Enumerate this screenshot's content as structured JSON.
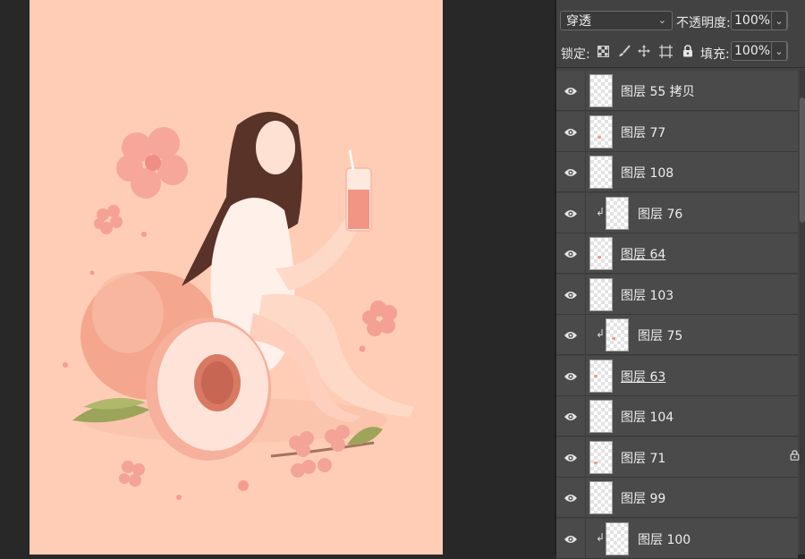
{
  "layers_panel": {
    "blend_mode": "穿透",
    "opacity_label": "不透明度:",
    "opacity_value": "100%",
    "lock_label": "锁定:",
    "fill_label": "填充:",
    "fill_value": "100%",
    "layers": [
      {
        "name": "图层 55 拷贝",
        "clipped": false,
        "underlined": false,
        "locked": false
      },
      {
        "name": "图层 77",
        "clipped": false,
        "underlined": false,
        "locked": false
      },
      {
        "name": "图层 108",
        "clipped": false,
        "underlined": false,
        "locked": false
      },
      {
        "name": "图层 76",
        "clipped": true,
        "underlined": false,
        "locked": false
      },
      {
        "name": "图层 64",
        "clipped": false,
        "underlined": true,
        "locked": false
      },
      {
        "name": "图层 103",
        "clipped": false,
        "underlined": false,
        "locked": false
      },
      {
        "name": "图层 75",
        "clipped": true,
        "underlined": false,
        "locked": false
      },
      {
        "name": "图层 63",
        "clipped": false,
        "underlined": true,
        "locked": false
      },
      {
        "name": "图层 104",
        "clipped": false,
        "underlined": false,
        "locked": false
      },
      {
        "name": "图层 71",
        "clipped": false,
        "underlined": false,
        "locked": true
      },
      {
        "name": "图层 99",
        "clipped": false,
        "underlined": false,
        "locked": false
      },
      {
        "name": "图层 100",
        "clipped": true,
        "underlined": false,
        "locked": false
      }
    ]
  },
  "icons": {
    "visibility": "eye-icon",
    "clip": "clipping-arrow-icon",
    "lock": "lock-icon",
    "lock_transparent": "lock-transparent-pixels-icon",
    "lock_image": "lock-image-pixels-icon",
    "lock_position": "lock-position-icon",
    "lock_artboard": "lock-artboard-icon"
  },
  "colors": {
    "artboard_background": "#ffcdb6",
    "panel_background": "#424242",
    "workspace_background": "#282828"
  }
}
